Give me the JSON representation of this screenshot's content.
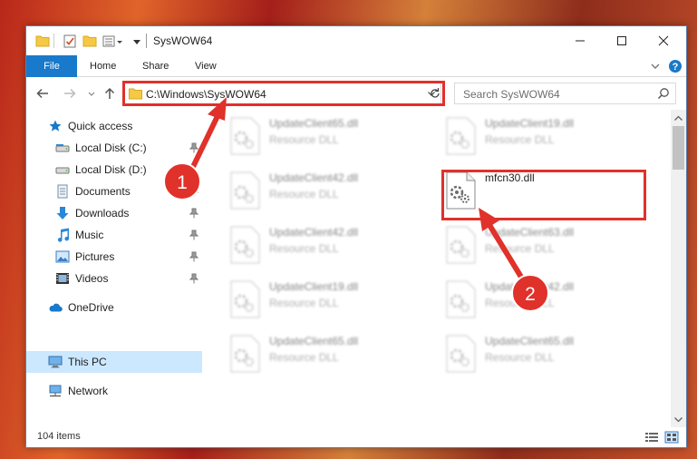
{
  "window": {
    "title": "SysWOW64"
  },
  "ribbon": {
    "tabs": [
      "File",
      "Home",
      "Share",
      "View"
    ]
  },
  "address": {
    "path": "C:\\Windows\\SysWOW64"
  },
  "search": {
    "placeholder": "Search SysWOW64"
  },
  "sidebar": {
    "items": [
      {
        "label": "Quick access",
        "icon": "star-icon"
      },
      {
        "label": "Local Disk (C:)",
        "icon": "drive-icon",
        "pinned": true
      },
      {
        "label": "Local Disk (D:)",
        "icon": "drive-icon",
        "pinned": true
      },
      {
        "label": "Documents",
        "icon": "documents-icon",
        "pinned": true
      },
      {
        "label": "Downloads",
        "icon": "download-icon",
        "pinned": true
      },
      {
        "label": "Music",
        "icon": "music-icon",
        "pinned": true
      },
      {
        "label": "Pictures",
        "icon": "pictures-icon",
        "pinned": true
      },
      {
        "label": "Videos",
        "icon": "videos-icon",
        "pinned": true
      },
      {
        "label": "OneDrive",
        "icon": "cloud-icon"
      },
      {
        "label": "This PC",
        "icon": "computer-icon",
        "selected": true
      },
      {
        "label": "Network",
        "icon": "network-icon"
      }
    ]
  },
  "files": [
    {
      "name": "UpdateClient65.dll",
      "type": "Resource DLL"
    },
    {
      "name": "UpdateClient19.dll",
      "type": "Resource DLL"
    },
    {
      "name": "UpdateClient42.dll",
      "type": "Resource DLL"
    },
    {
      "name": "mfcn30.dll",
      "type": ""
    },
    {
      "name": "UpdateClient42.dll",
      "type": "Resource DLL"
    },
    {
      "name": "UpdateClient63.dll",
      "type": "Resource DLL"
    },
    {
      "name": "UpdateClient19.dll",
      "type": "Resource DLL"
    },
    {
      "name": "UpdateClient42.dll",
      "type": "Resource DLL"
    },
    {
      "name": "UpdateClient65.dll",
      "type": "Resource DLL"
    },
    {
      "name": "UpdateClient65.dll",
      "type": "Resource DLL"
    }
  ],
  "status": {
    "count": "104 items"
  },
  "annotations": {
    "step1": "1",
    "step2": "2"
  },
  "colors": {
    "accent": "#1979ca",
    "highlight": "#e0312a",
    "selection": "#cce8ff"
  }
}
